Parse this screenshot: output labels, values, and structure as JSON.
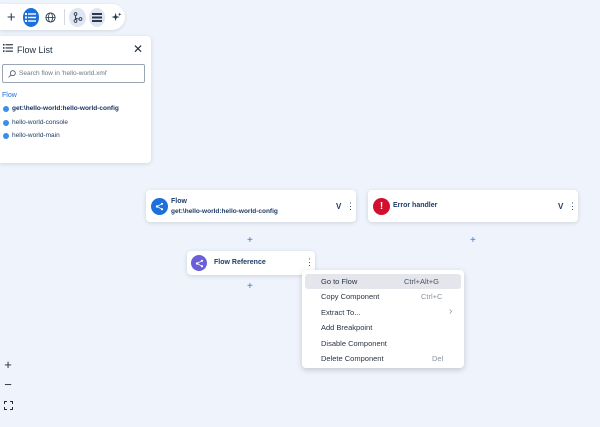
{
  "toolbar": {
    "buttons": [
      {
        "name": "add",
        "glyph": "+"
      },
      {
        "name": "flow-list",
        "glyph": "list",
        "active": true
      },
      {
        "name": "globe",
        "glyph": "globe"
      },
      {
        "name": "branch",
        "glyph": "branch"
      },
      {
        "name": "stack",
        "glyph": "stack"
      },
      {
        "name": "sparkle",
        "glyph": "sparkle"
      }
    ]
  },
  "flow_list": {
    "title": "Flow List",
    "close": "✕",
    "search_placeholder": "Search flow in 'hello-world.xml'",
    "section_label": "Flow",
    "items": [
      {
        "label": "get:\\hello-world:hello-world-config",
        "selected": true
      },
      {
        "label": "hello-world-console",
        "selected": false
      },
      {
        "label": "hello-world-main",
        "selected": false
      }
    ]
  },
  "canvas": {
    "flow_node": {
      "title": "Flow",
      "subtitle": "get:\\hello-world:hello-world-config",
      "chevron": "V",
      "menu": "⋮"
    },
    "error_node": {
      "title": "Error handler",
      "chevron": "V",
      "menu": "⋮"
    },
    "reference_node": {
      "title": "Flow Reference",
      "menu": "⋮"
    },
    "plus": "+"
  },
  "context_menu": {
    "items": [
      {
        "label": "Go to Flow",
        "shortcut": "Ctrl+Alt+G",
        "highlighted": true
      },
      {
        "label": "Copy Component",
        "shortcut": "Ctrl+C"
      },
      {
        "label": "Extract To...",
        "submenu": true
      },
      {
        "label": "Add Breakpoint",
        "shortcut": ""
      },
      {
        "label": "Disable Component",
        "shortcut": ""
      },
      {
        "label": "Delete Component",
        "shortcut": "Del"
      }
    ]
  },
  "zoom_controls": {
    "zoom_in": "+",
    "zoom_out": "−"
  },
  "colors": {
    "accent": "#1d6fdb",
    "error": "#d0102e",
    "reference": "#6a5fd8",
    "background": "#eef3fc"
  }
}
